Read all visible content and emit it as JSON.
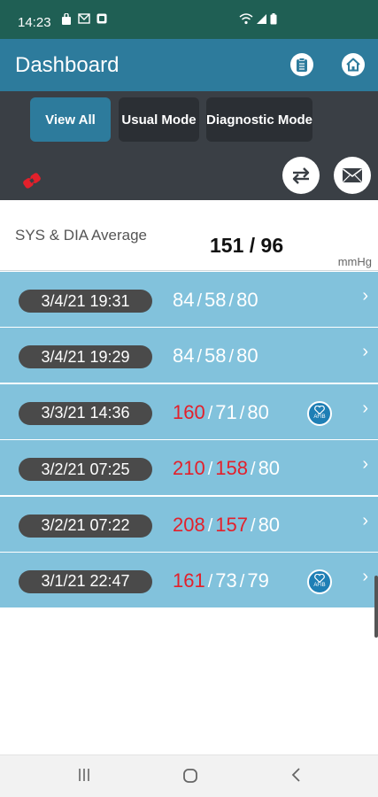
{
  "status_bar": {
    "time": "14:23",
    "notification_icons": [
      "bag-icon",
      "envelope-icon",
      "square-app-icon"
    ],
    "status_icons": [
      "wifi-icon",
      "signal-icon",
      "battery-icon"
    ]
  },
  "header": {
    "title": "Dashboard",
    "actions": [
      "clipboard-icon",
      "home-icon"
    ]
  },
  "filters": {
    "tabs": [
      {
        "label": "View All",
        "active": true
      },
      {
        "label": "Usual Mode",
        "active": false
      },
      {
        "label": "Diagnostic Mode",
        "active": false
      }
    ]
  },
  "toolbar": {
    "bluetooth_status_icon": "bluetooth-connected-icon",
    "sync_icon": "sync-icon",
    "mail_icon": "mail-icon"
  },
  "average": {
    "label": "SYS & DIA Average",
    "value": "151 / 96",
    "unit": "mmHg"
  },
  "readings": [
    {
      "datetime": "3/4/21 19:31",
      "sys": "84",
      "dia": "58",
      "pulse": "80",
      "sys_high": false,
      "dia_high": false,
      "afib": false
    },
    {
      "datetime": "3/4/21 19:29",
      "sys": "84",
      "dia": "58",
      "pulse": "80",
      "sys_high": false,
      "dia_high": false,
      "afib": false
    },
    {
      "datetime": "3/3/21 14:36",
      "sys": "160",
      "dia": "71",
      "pulse": "80",
      "sys_high": true,
      "dia_high": false,
      "afib": true
    },
    {
      "datetime": "3/2/21 07:25",
      "sys": "210",
      "dia": "158",
      "pulse": "80",
      "sys_high": true,
      "dia_high": true,
      "afib": false
    },
    {
      "datetime": "3/2/21 07:22",
      "sys": "208",
      "dia": "157",
      "pulse": "80",
      "sys_high": true,
      "dia_high": true,
      "afib": false
    },
    {
      "datetime": "3/1/21 22:47",
      "sys": "161",
      "dia": "73",
      "pulse": "79",
      "sys_high": true,
      "dia_high": false,
      "afib": true
    }
  ],
  "separator": "/",
  "afib_label": "AFIB",
  "colors": {
    "status_bar": "#1f5f54",
    "app_bar": "#2d7b9c",
    "filter_panel": "#3a3f45",
    "row_bg": "#82c2dc",
    "high_value": "#e3202b",
    "afib_badge": "#1f7fb5"
  },
  "nav_bar": {
    "buttons": [
      "recents-icon",
      "home-circle-icon",
      "back-icon"
    ]
  }
}
